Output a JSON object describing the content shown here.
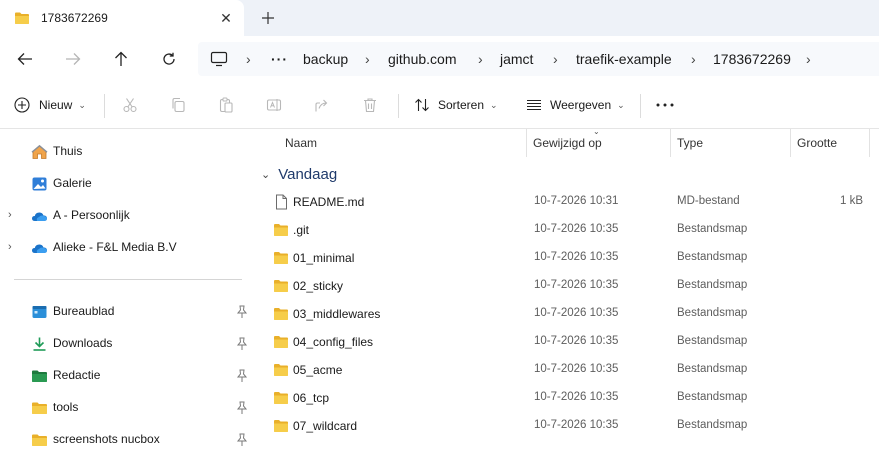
{
  "tab": {
    "title": "1783672269"
  },
  "breadcrumb": [
    "backup",
    "github.com",
    "jamct",
    "traefik-example",
    "1783672269"
  ],
  "toolbar": {
    "new_label": "Nieuw",
    "sort_label": "Sorteren",
    "view_label": "Weergeven"
  },
  "sidebar": {
    "top_items": [
      {
        "label": "Thuis",
        "icon": "home-icon"
      },
      {
        "label": "Galerie",
        "icon": "gallery-icon"
      },
      {
        "label": "A - Persoonlijk",
        "icon": "onedrive-cloud-icon"
      },
      {
        "label": "Alieke - F&L Media B.V",
        "icon": "onedrive-cloud-icon"
      }
    ],
    "pinned_items": [
      {
        "label": "Bureaublad",
        "icon": "desktop-icon"
      },
      {
        "label": "Downloads",
        "icon": "download-icon"
      },
      {
        "label": "Redactie",
        "icon": "folder-green-icon"
      },
      {
        "label": "tools",
        "icon": "folder-icon"
      },
      {
        "label": "screenshots nucbox",
        "icon": "folder-icon"
      }
    ]
  },
  "columns": {
    "name": "Naam",
    "modified": "Gewijzigd op",
    "type": "Type",
    "size": "Grootte"
  },
  "group": {
    "label": "Vandaag"
  },
  "files": [
    {
      "name": "README.md",
      "modified": "10-7-2026 10:31",
      "type": "MD-bestand",
      "size": "1 kB",
      "kind": "file"
    },
    {
      "name": ".git",
      "modified": "10-7-2026 10:35",
      "type": "Bestandsmap",
      "size": "",
      "kind": "folder"
    },
    {
      "name": "01_minimal",
      "modified": "10-7-2026 10:35",
      "type": "Bestandsmap",
      "size": "",
      "kind": "folder"
    },
    {
      "name": "02_sticky",
      "modified": "10-7-2026 10:35",
      "type": "Bestandsmap",
      "size": "",
      "kind": "folder"
    },
    {
      "name": "03_middlewares",
      "modified": "10-7-2026 10:35",
      "type": "Bestandsmap",
      "size": "",
      "kind": "folder"
    },
    {
      "name": "04_config_files",
      "modified": "10-7-2026 10:35",
      "type": "Bestandsmap",
      "size": "",
      "kind": "folder"
    },
    {
      "name": "05_acme",
      "modified": "10-7-2026 10:35",
      "type": "Bestandsmap",
      "size": "",
      "kind": "folder"
    },
    {
      "name": "06_tcp",
      "modified": "10-7-2026 10:35",
      "type": "Bestandsmap",
      "size": "",
      "kind": "folder"
    },
    {
      "name": "07_wildcard",
      "modified": "10-7-2026 10:35",
      "type": "Bestandsmap",
      "size": "",
      "kind": "folder"
    }
  ],
  "colors": {
    "folder": "#f4c53c",
    "accent": "#0067c0",
    "group_heading": "#1f3a6b"
  }
}
